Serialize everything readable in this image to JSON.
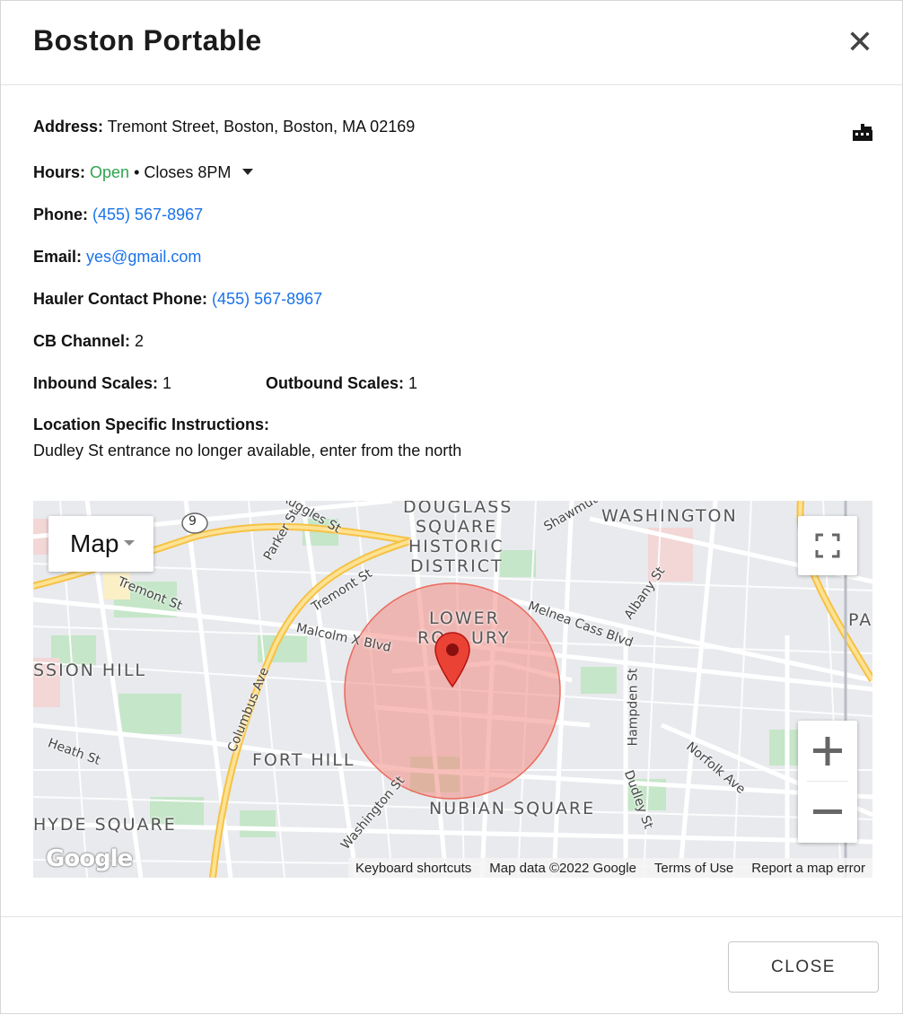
{
  "modal": {
    "title": "Boston Portable"
  },
  "details": {
    "address_label": "Address:",
    "address_value": "Tremont Street, Boston, Boston, MA 02169",
    "hours_label": "Hours:",
    "hours_status": "Open",
    "hours_rest": " • Closes 8PM",
    "phone_label": "Phone:",
    "phone_value": "(455) 567-8967",
    "email_label": "Email:",
    "email_value": "yes@gmail.com",
    "hauler_label": "Hauler Contact Phone:",
    "hauler_value": "(455) 567-8967",
    "cb_label": "CB Channel:",
    "cb_value": "2",
    "inbound_label": "Inbound Scales:",
    "inbound_value": "1",
    "outbound_label": "Outbound Scales:",
    "outbound_value": "1",
    "instructions_label": "Location Specific Instructions:",
    "instructions_value": "Dudley St entrance no longer available, enter from the north"
  },
  "map": {
    "type_label": "Map",
    "route_shield": "9",
    "areas": [
      "DOUGLASS",
      "SQUARE",
      "HISTORIC",
      "DISTRICT",
      "WASHINGTON",
      "LOWER",
      "RO",
      "URY",
      "SSION HILL",
      "FORT HILL",
      "NUBIAN SQUARE",
      "HYDE SQUARE",
      "PA"
    ],
    "streets": [
      "Ruggles St",
      "Parker St",
      "Tremont St",
      "Tremont St",
      "Malcolm X Blvd",
      "Columbus Ave",
      "Melnea Cass Blvd",
      "Albany St",
      "Hampden St",
      "Heath St",
      "Washington St",
      "Dudley St",
      "Norfolk Ave",
      "Shawmut"
    ],
    "attribution": {
      "shortcuts": "Keyboard shortcuts",
      "data": "Map data ©2022 Google",
      "terms": "Terms of Use",
      "report": "Report a map error"
    },
    "logo": "Google",
    "marker_color": "#ea4335",
    "radius_color": "#f28b82"
  },
  "footer": {
    "close_label": "CLOSE"
  }
}
